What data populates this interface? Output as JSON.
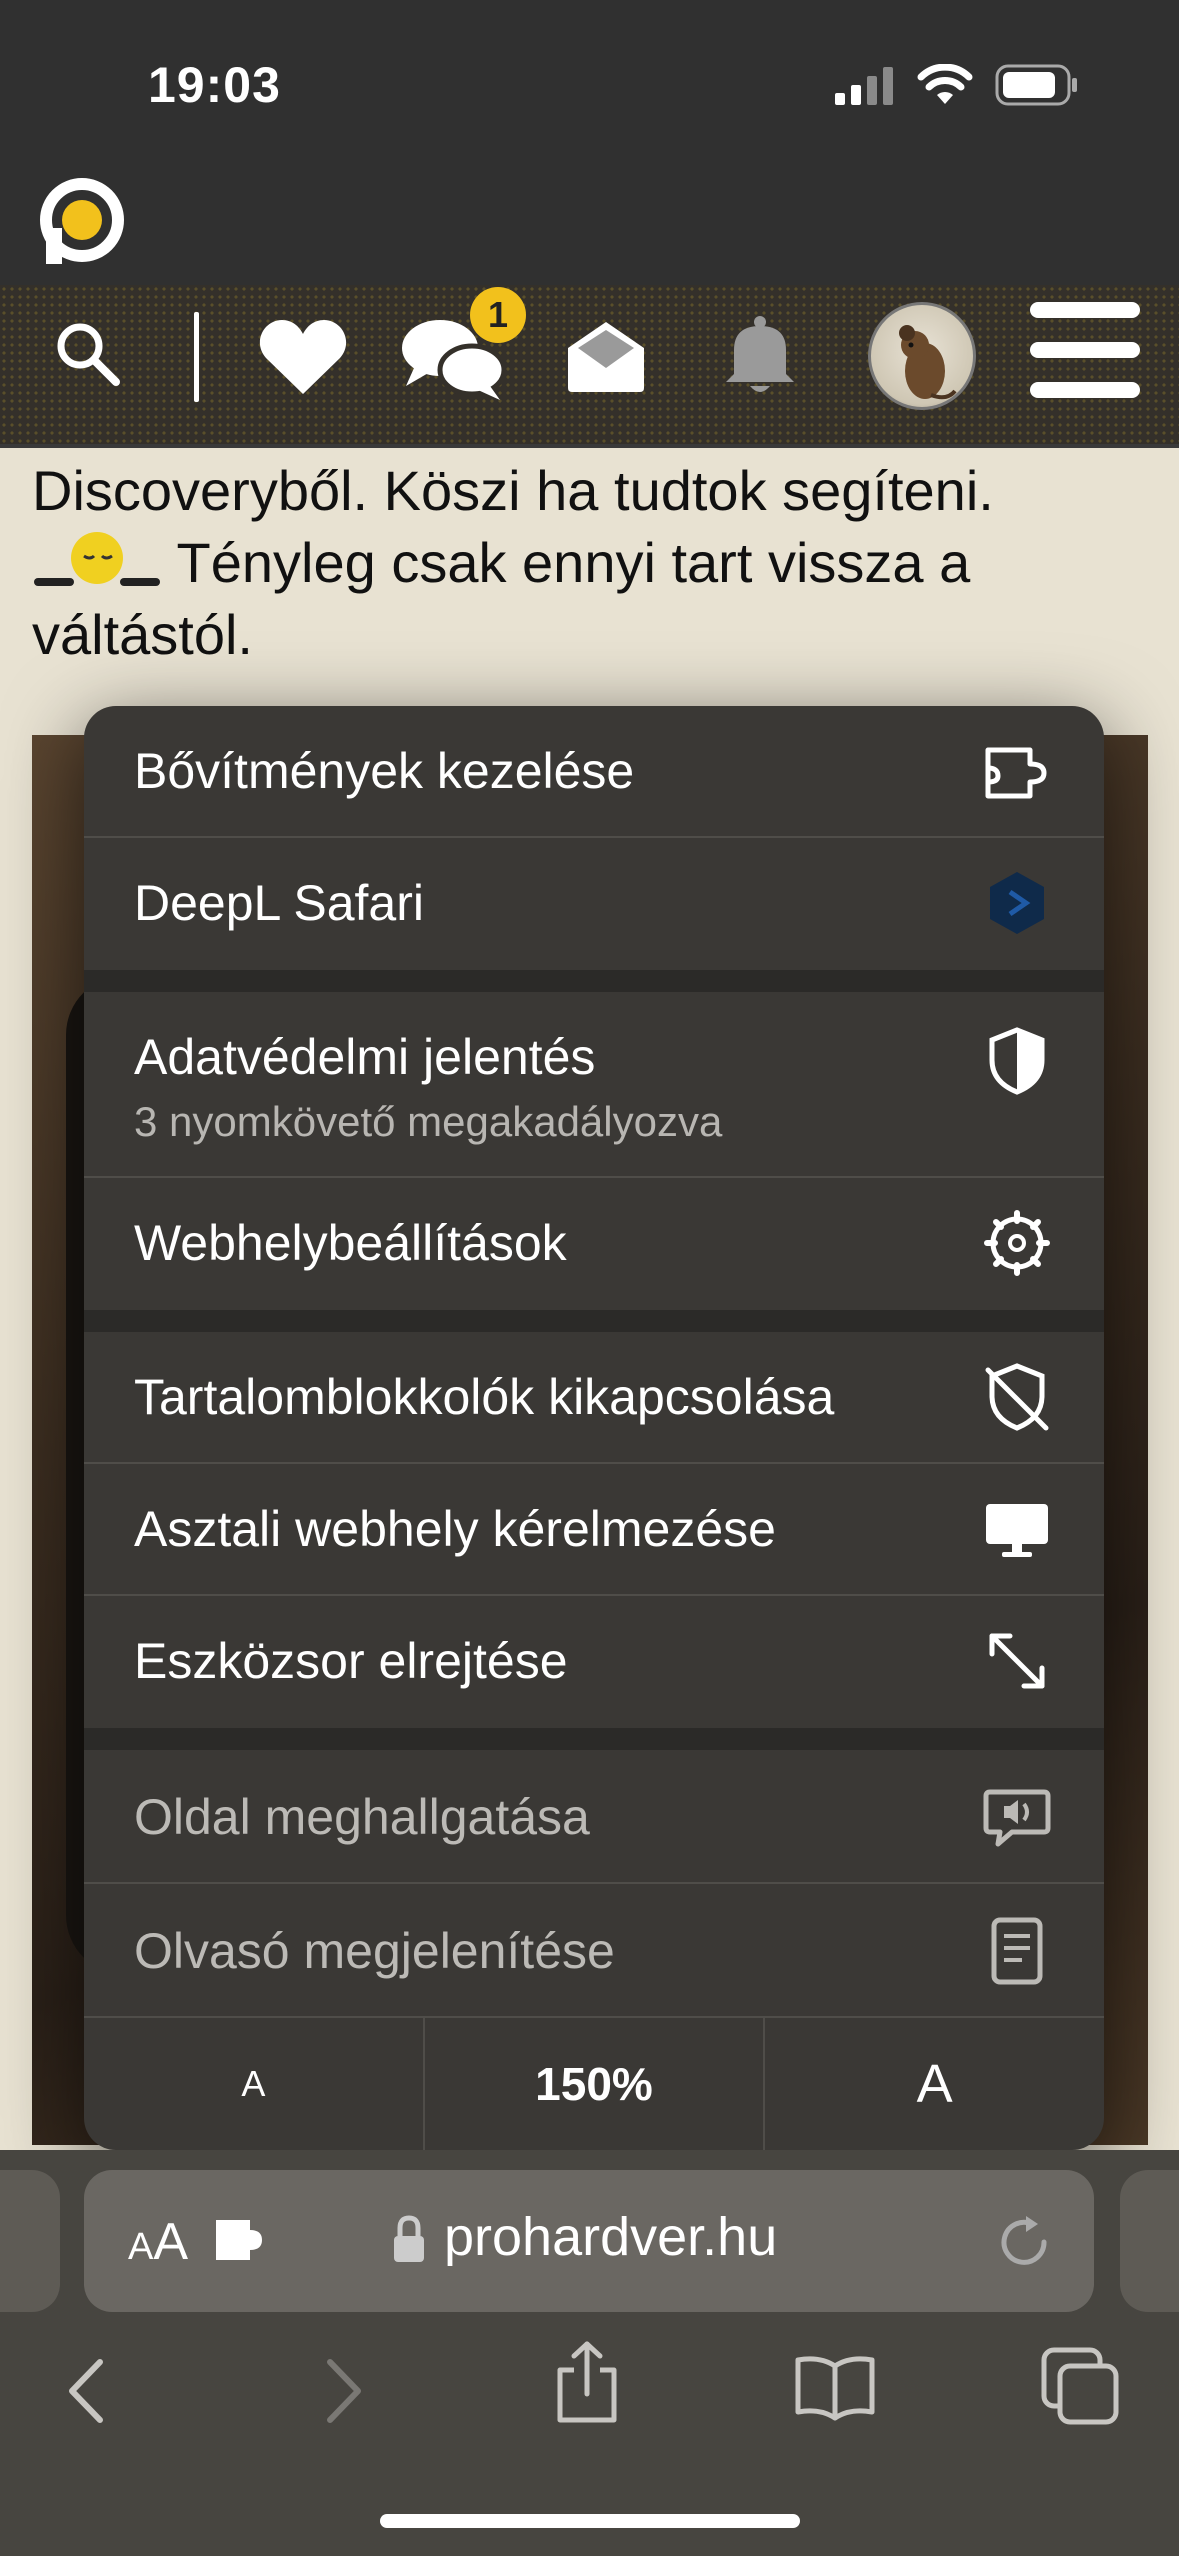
{
  "status_bar": {
    "time": "19:03"
  },
  "site_header": {
    "logo": "prohardver-logo",
    "nav_icons": [
      "search-icon",
      "heart-icon",
      "chat-icon",
      "mail-icon",
      "bell-icon",
      "avatar",
      "hamburger-menu-icon"
    ],
    "chat_badge_count": "1"
  },
  "page_text": {
    "line1": "Discoveryből. Köszi ha tudtok segíteni.",
    "line2": " Tényleg csak ennyi tart vissza a",
    "line3": "váltástól."
  },
  "menu": {
    "items": [
      {
        "label": "Bővítmények kezelése",
        "icon": "extension-icon"
      },
      {
        "label": "DeepL Safari",
        "icon": "deepl-icon"
      },
      {
        "label": "Adatvédelmi jelentés",
        "sublabel": "3 nyomkövető megakadályozva",
        "icon": "shield-icon"
      },
      {
        "label": "Webhelybeállítások",
        "icon": "gear-icon"
      },
      {
        "label": "Tartalomblokkolók kikapcsolása",
        "icon": "shield-slash-icon"
      },
      {
        "label": "Asztali webhely kérelmezése",
        "icon": "desktop-icon"
      },
      {
        "label": "Eszközsor elrejtése",
        "icon": "expand-arrows-icon"
      },
      {
        "label": "Oldal meghallgatása",
        "icon": "speech-bubble-icon"
      },
      {
        "label": "Olvasó megjelenítése",
        "icon": "reader-icon"
      }
    ],
    "zoom": {
      "decrease_label": "A",
      "value": "150%",
      "increase_label": "A"
    }
  },
  "address_bar": {
    "aa_small": "A",
    "aa_large": "A",
    "url": "prohardver.hu"
  },
  "toolbar": [
    "back-icon",
    "forward-icon",
    "share-icon",
    "bookmarks-icon",
    "tabs-icon"
  ],
  "colors": {
    "header_bg": "#303030",
    "accent_yellow": "#f2c11c",
    "menu_bg": "#3a3835",
    "page_bg": "#e8e2d2"
  }
}
